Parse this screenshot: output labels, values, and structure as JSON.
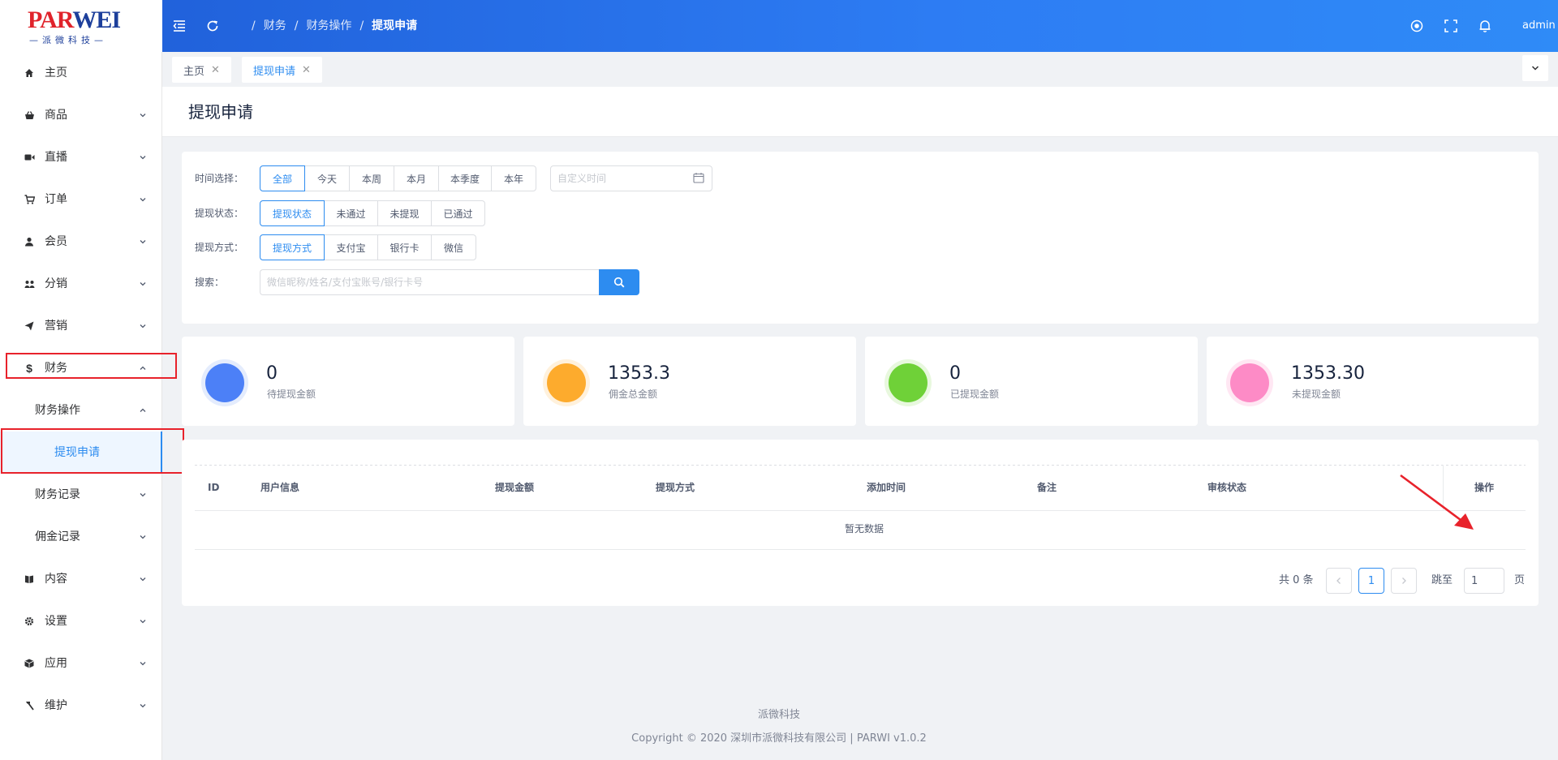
{
  "header": {
    "logo_main_a": "PAR",
    "logo_main_b": "WEI",
    "logo_sub": "—派微科技—",
    "breadcrumb": [
      "财务",
      "财务操作",
      "提现申请"
    ],
    "user": "admin"
  },
  "sidebar": {
    "items": [
      {
        "label": "主页",
        "icon": "home-icon"
      },
      {
        "label": "商品",
        "icon": "basket-icon"
      },
      {
        "label": "直播",
        "icon": "video-icon"
      },
      {
        "label": "订单",
        "icon": "cart-icon"
      },
      {
        "label": "会员",
        "icon": "user-icon"
      },
      {
        "label": "分销",
        "icon": "share-icon"
      },
      {
        "label": "营销",
        "icon": "send-icon"
      },
      {
        "label": "财务",
        "icon": "dollar-icon"
      },
      {
        "label": "财务操作"
      },
      {
        "label": "提现申请"
      },
      {
        "label": "财务记录"
      },
      {
        "label": "佣金记录"
      },
      {
        "label": "内容",
        "icon": "book-icon"
      },
      {
        "label": "设置",
        "icon": "gear-icon"
      },
      {
        "label": "应用",
        "icon": "cube-icon"
      },
      {
        "label": "维护",
        "icon": "hammer-icon"
      }
    ]
  },
  "tabs": [
    {
      "label": "主页"
    },
    {
      "label": "提现申请"
    }
  ],
  "page": {
    "title": "提现申请"
  },
  "filters": {
    "time_label": "时间选择：",
    "time_options": [
      "全部",
      "今天",
      "本周",
      "本月",
      "本季度",
      "本年"
    ],
    "date_placeholder": "自定义时间",
    "status_label": "提现状态：",
    "status_options": [
      "提现状态",
      "未通过",
      "未提现",
      "已通过"
    ],
    "method_label": "提现方式：",
    "method_options": [
      "提现方式",
      "支付宝",
      "银行卡",
      "微信"
    ],
    "search_label": "搜索：",
    "search_placeholder": "微信昵称/姓名/支付宝账号/银行卡号"
  },
  "stats": [
    {
      "value": "0",
      "label": "待提现金额",
      "color": "#4c80f7",
      "ring": "#e4ecfd"
    },
    {
      "value": "1353.3",
      "label": "佣金总金额",
      "color": "#fdab2d",
      "ring": "#fff1dc"
    },
    {
      "value": "0",
      "label": "已提现金额",
      "color": "#6fd138",
      "ring": "#e8f8de"
    },
    {
      "value": "1353.30",
      "label": "未提现金额",
      "color": "#fd8bc6",
      "ring": "#ffe7f3"
    }
  ],
  "table": {
    "columns": [
      "ID",
      "用户信息",
      "提现金额",
      "提现方式",
      "添加时间",
      "备注",
      "审核状态",
      "操作"
    ],
    "empty_text": "暂无数据"
  },
  "pagination": {
    "total_text": "共 0 条",
    "current_page": "1",
    "jump_label": "跳至",
    "jump_value": "1",
    "page_suffix": "页"
  },
  "footer": {
    "line1": "派微科技",
    "line2": "Copyright © 2020 深圳市派微科技有限公司 | PARWI v1.0.2"
  },
  "colors": {
    "accent": "#2d8cf0",
    "highlight_box": "#e8222b",
    "header_gradient_start": "#1e5cd6",
    "header_gradient_end": "#2f8bf7"
  }
}
